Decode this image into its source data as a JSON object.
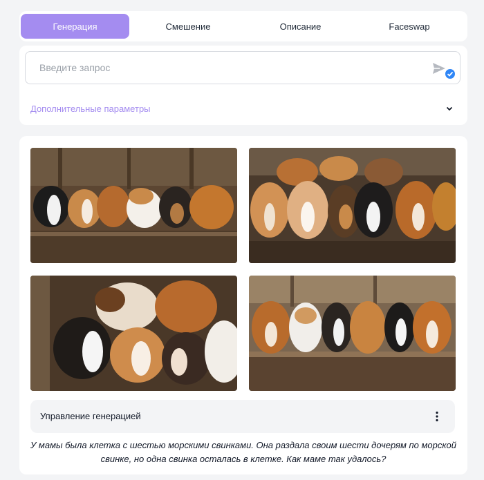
{
  "tabs": [
    {
      "label": "Генерация",
      "active": true
    },
    {
      "label": "Смешение",
      "active": false
    },
    {
      "label": "Описание",
      "active": false
    },
    {
      "label": "Faceswap",
      "active": false
    }
  ],
  "prompt": {
    "placeholder": "Введите запрос",
    "send_icon": "send-icon",
    "badge_icon": "check-icon"
  },
  "advanced": {
    "label": "Дополнительные параметры",
    "icon": "chevron-down-icon"
  },
  "gallery": {
    "images": [
      {
        "name": "guinea-pigs-1"
      },
      {
        "name": "guinea-pigs-2"
      },
      {
        "name": "guinea-pigs-3"
      },
      {
        "name": "guinea-pigs-4"
      }
    ]
  },
  "control": {
    "title": "Управление генерацией",
    "icon": "more-vertical-icon"
  },
  "caption": {
    "line1": "У мамы была клетка с шестью морскими свинками. Она раздала своим шести дочерям по морской",
    "line2": "свинке, но одна свинка осталась в клетке. Как маме так удалось?"
  },
  "colors": {
    "accent": "#a48cf0",
    "badge": "#2f86f6",
    "background": "#f3f4f6"
  }
}
